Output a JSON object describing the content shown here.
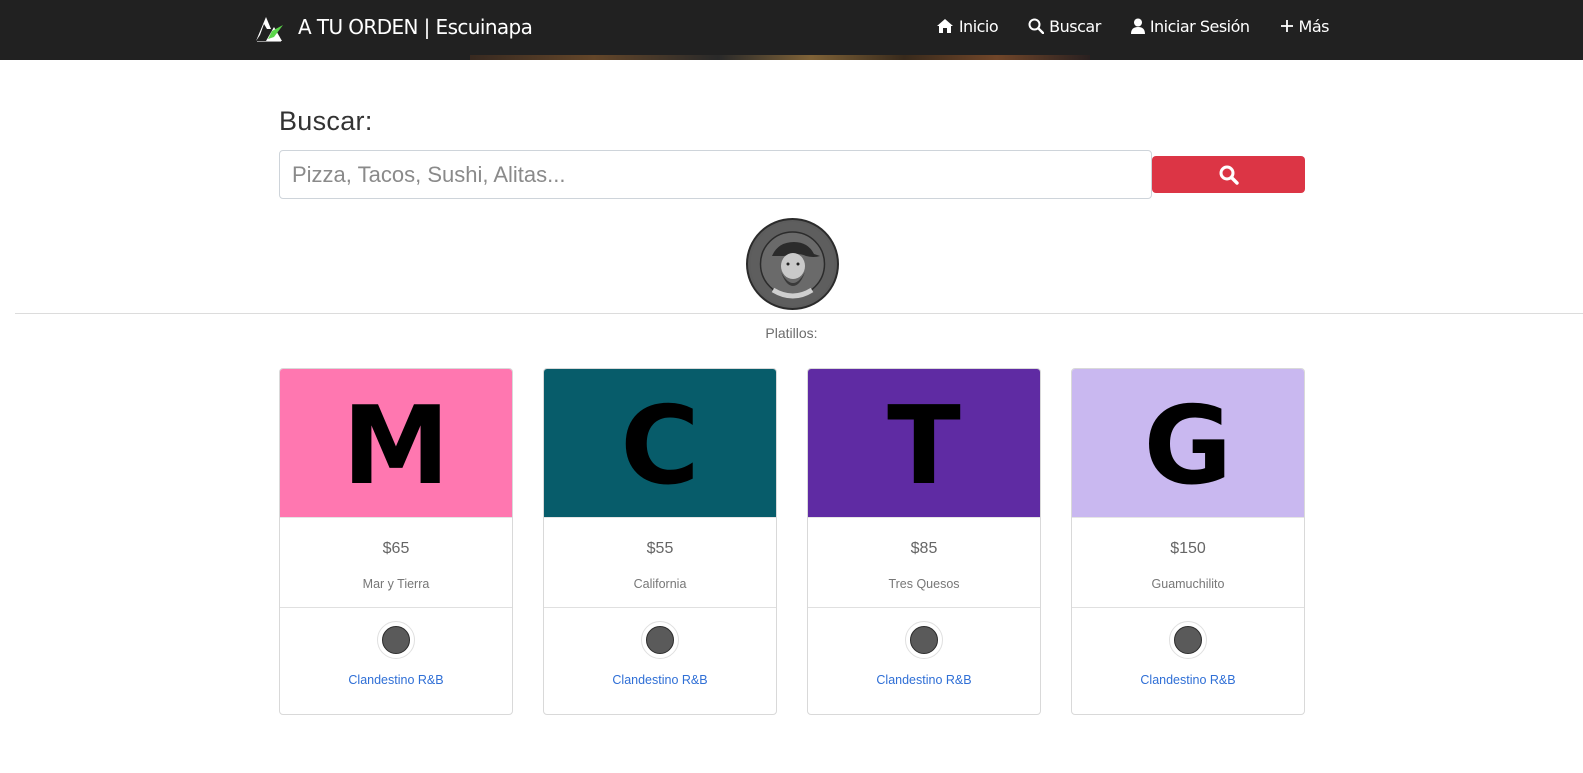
{
  "nav": {
    "brand": "A TU ORDEN | Escuinapa",
    "links": [
      {
        "label": "Inicio",
        "icon": "home-icon"
      },
      {
        "label": "Buscar",
        "icon": "search-icon"
      },
      {
        "label": "Iniciar Sesión",
        "icon": "user-icon"
      },
      {
        "label": "Más",
        "icon": "plus-icon"
      }
    ]
  },
  "search": {
    "label": "Buscar:",
    "placeholder": "Pizza, Tacos, Sushi, Alitas...",
    "button_icon": "search-icon"
  },
  "section": {
    "title": "Platillos:"
  },
  "dishes": [
    {
      "letter": "M",
      "price": "$65",
      "name": "Mar y Tierra",
      "restaurant": "Clandestino R&B",
      "color": "#ff77b0"
    },
    {
      "letter": "C",
      "price": "$55",
      "name": "California",
      "restaurant": "Clandestino R&B",
      "color": "#075c6a"
    },
    {
      "letter": "T",
      "price": "$85",
      "name": "Tres Quesos",
      "restaurant": "Clandestino R&B",
      "color": "#5f2ba3"
    },
    {
      "letter": "G",
      "price": "$150",
      "name": "Guamuchilito",
      "restaurant": "Clandestino R&B",
      "color": "#c9b8f0"
    }
  ],
  "colors": {
    "navbar": "#212121",
    "search_button": "#dc3545",
    "link": "#2f6fd6"
  }
}
